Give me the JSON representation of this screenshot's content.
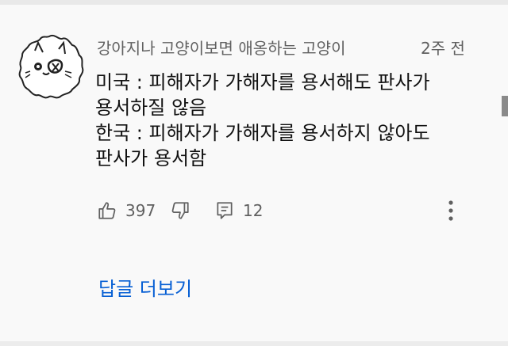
{
  "comment": {
    "author": "강아지나 고양이보면 애옹하는 고양이",
    "time": "2주 전",
    "lines": [
      "미국 : 피해자가 가해자를 용서해도 판사가",
      "용서하질 않음",
      "한국 : 피해자가 가해자를 용서하지 않아도",
      "판사가 용서함"
    ],
    "likes": "397",
    "replies": "12",
    "view_replies_label": "답글 더보기"
  },
  "icons": {
    "like": "thumbs-up-icon",
    "dislike": "thumbs-down-icon",
    "reply": "reply-comment-icon",
    "more": "more-vertical-icon"
  },
  "colors": {
    "background": "#f9f9f9",
    "meta_text": "#606060",
    "link": "#065fd4"
  }
}
